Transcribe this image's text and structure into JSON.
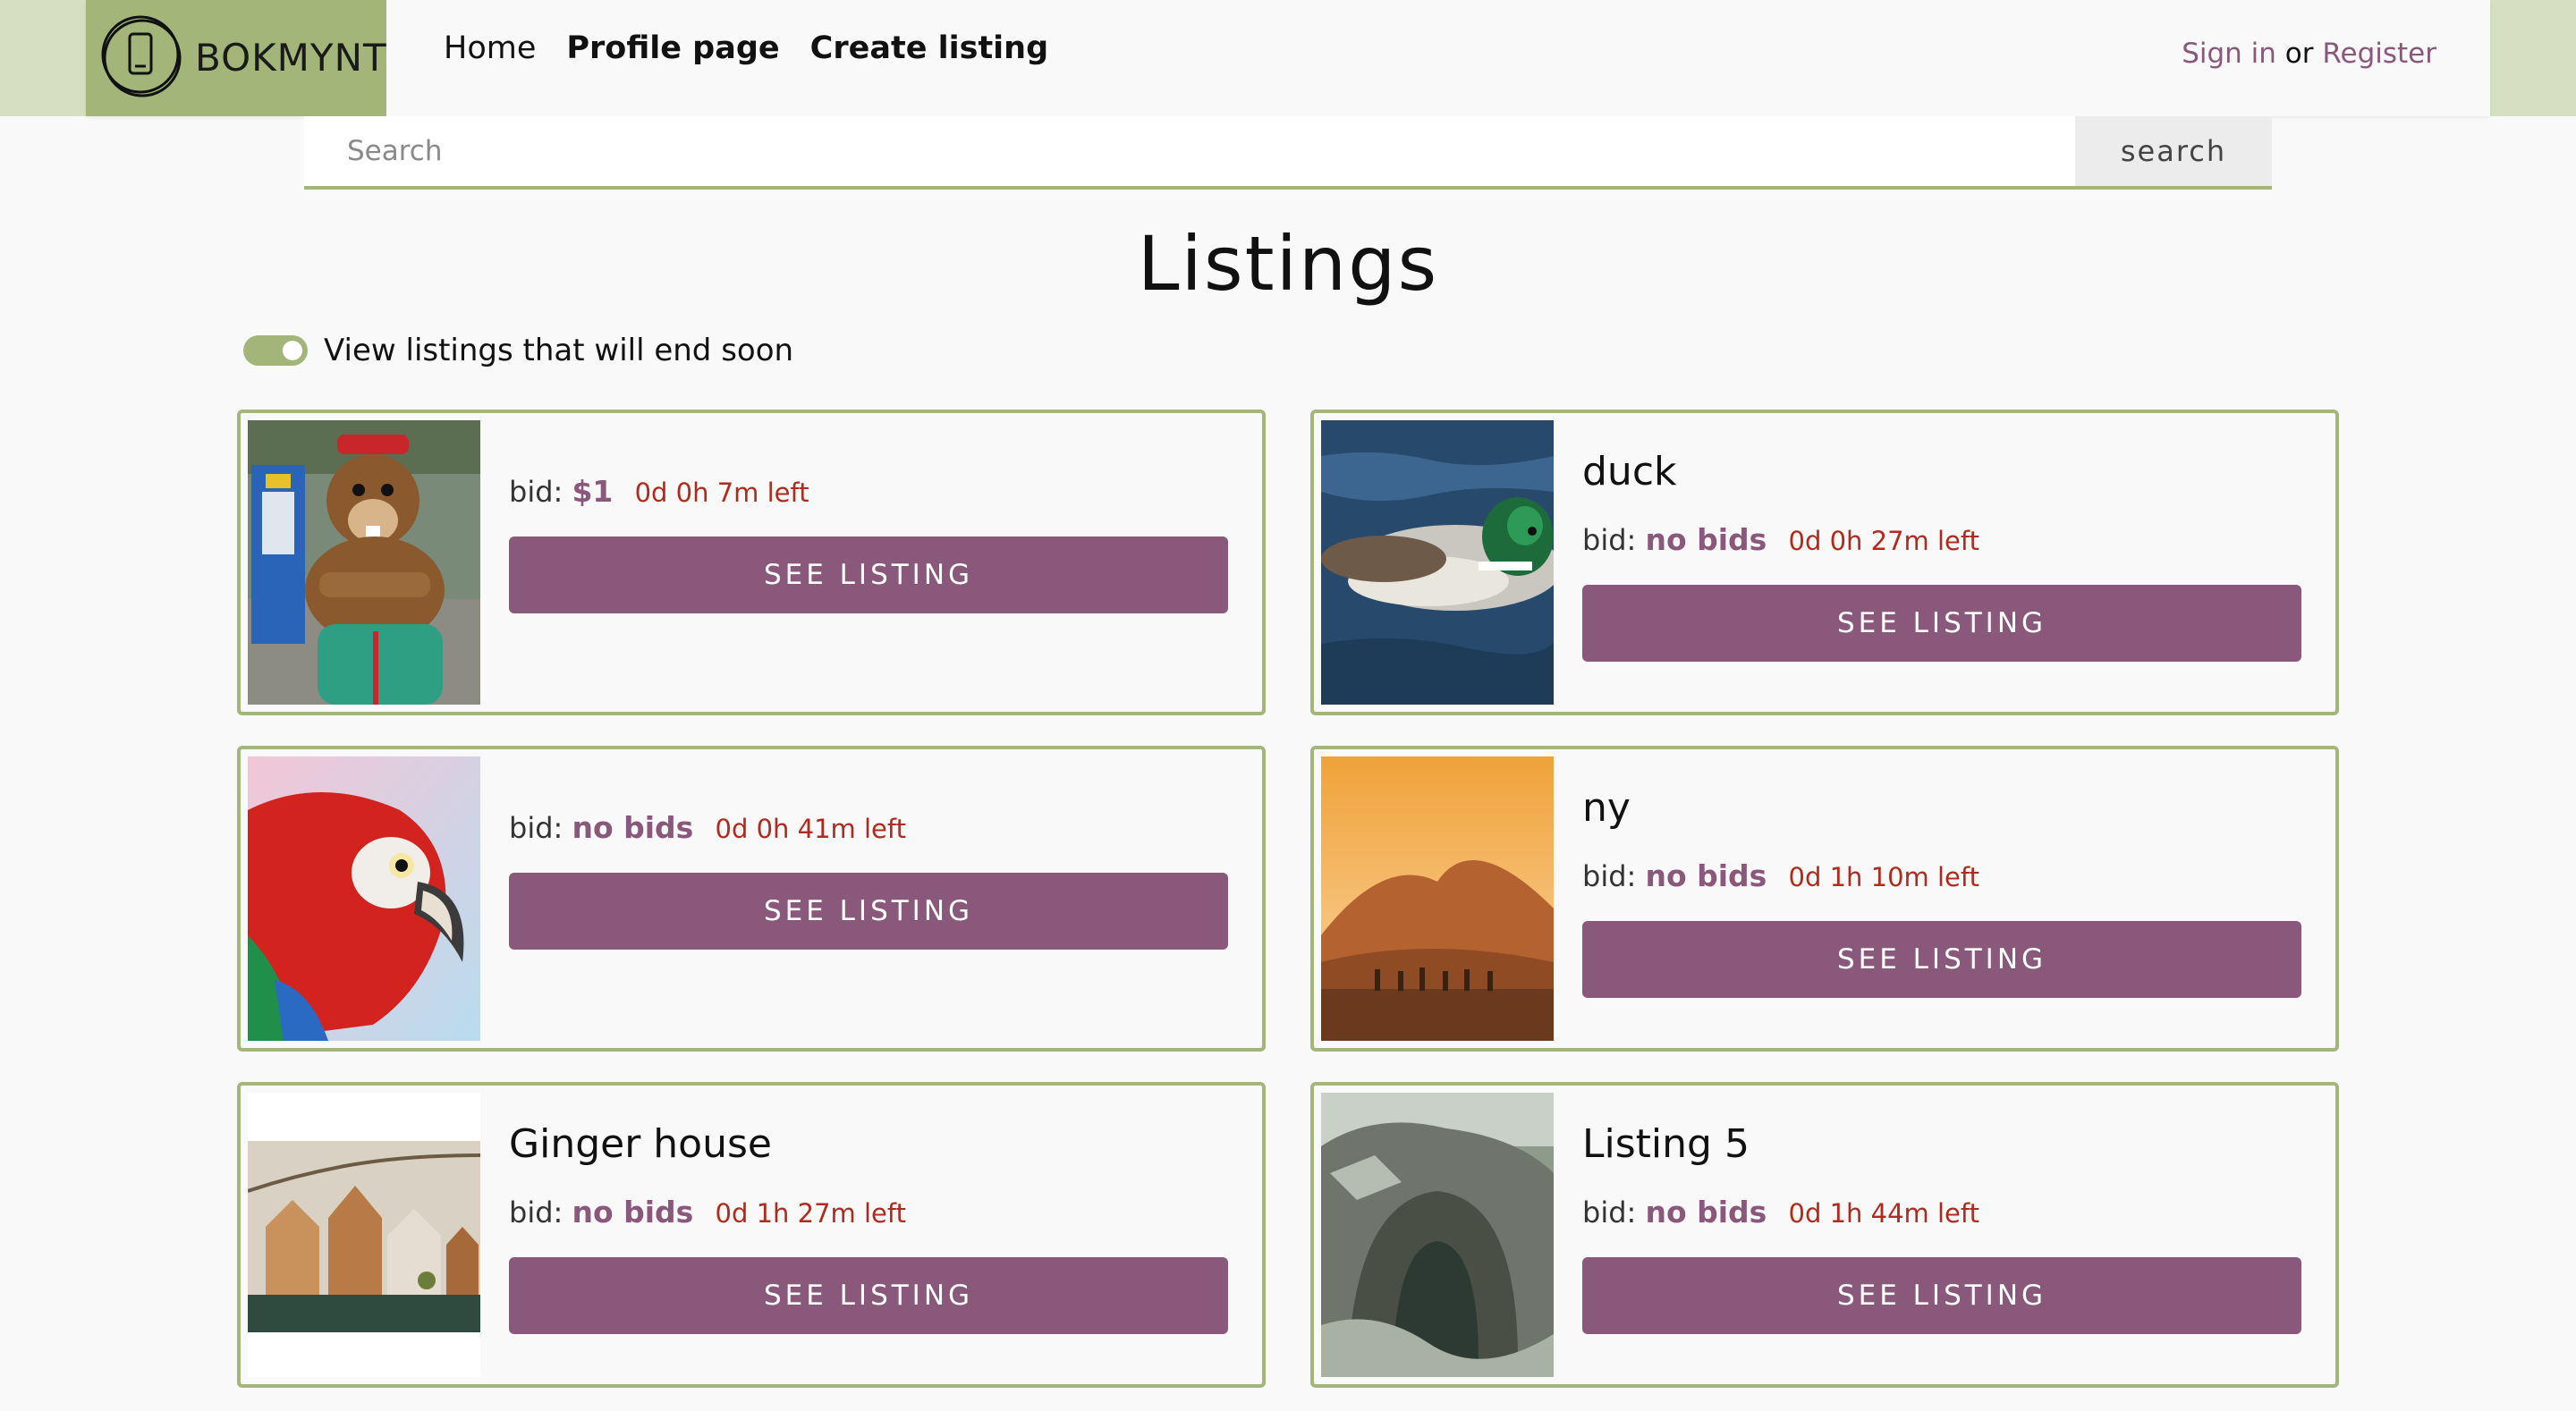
{
  "header": {
    "logo_text": "BOKMYNT",
    "nav": {
      "home": "Home",
      "profile": "Profile page",
      "create": "Create listing"
    },
    "auth": {
      "sign_in": "Sign in",
      "or": "or",
      "register": "Register"
    }
  },
  "search": {
    "placeholder": "Search",
    "button_label": "search"
  },
  "page": {
    "title": "Listings",
    "toggle_label": "View listings that will end soon",
    "toggle_on": true
  },
  "listings": [
    {
      "title": "",
      "bid_label": "bid:",
      "bid_value": "$1",
      "time_left": "0d 0h 7m left",
      "button_label": "SEE LISTING",
      "image": "beaver-mascot-photo"
    },
    {
      "title": "duck",
      "bid_label": "bid:",
      "bid_value": "no bids",
      "time_left": "0d 0h 27m left",
      "button_label": "SEE LISTING",
      "image": "duck-photo"
    },
    {
      "title": "",
      "bid_label": "bid:",
      "bid_value": "no bids",
      "time_left": "0d 0h 41m left",
      "button_label": "SEE LISTING",
      "image": "parrot-photo"
    },
    {
      "title": "ny",
      "bid_label": "bid:",
      "bid_value": "no bids",
      "time_left": "0d 1h 10m left",
      "button_label": "SEE LISTING",
      "image": "desert-photo"
    },
    {
      "title": "Ginger house",
      "bid_label": "bid:",
      "bid_value": "no bids",
      "time_left": "0d 1h 27m left",
      "button_label": "SEE LISTING",
      "image": "ginger-house-photo"
    },
    {
      "title": "Listing 5",
      "bid_label": "bid:",
      "bid_value": "no bids",
      "time_left": "0d 1h 44m left",
      "button_label": "SEE LISTING",
      "image": "rock-arch-photo"
    }
  ],
  "colors": {
    "accent_green": "#a4b57a",
    "accent_purple": "#8a587a",
    "time_red": "#b02a1e"
  }
}
